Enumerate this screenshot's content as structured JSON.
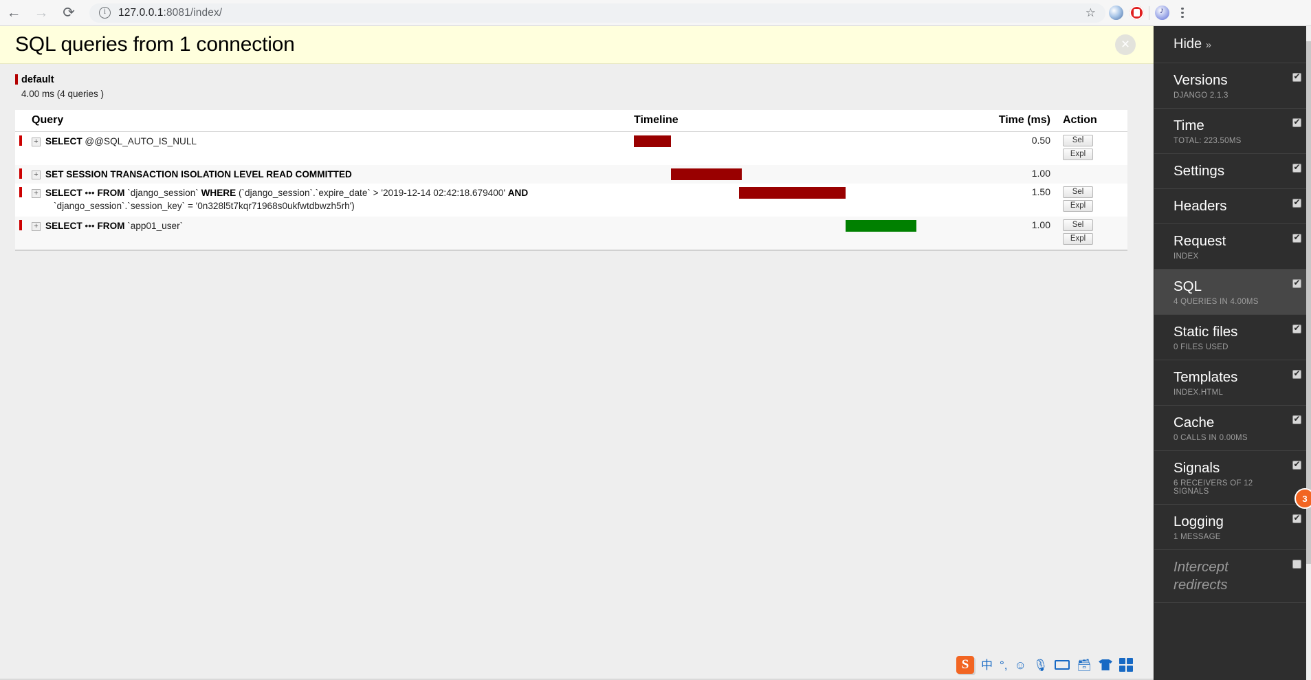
{
  "browser": {
    "back_label": "←",
    "forward_label": "→",
    "reload_label": "⟳",
    "url_host": "127.0.0.1",
    "url_rest": ":8081/index/",
    "star_label": "☆"
  },
  "djdt": {
    "title": "SQL queries from 1 connection",
    "close_label": "close",
    "connection": {
      "name": "default",
      "summary": "4.00 ms (4 queries )"
    },
    "table": {
      "headers": {
        "query": "Query",
        "timeline": "Timeline",
        "time": "Time (ms)",
        "action": "Action"
      },
      "rows": [
        {
          "toggle": "+",
          "sql_html": "<span class=\"kw\">SELECT</span> @@SQL_AUTO_IS_NULL",
          "sql_text": "SELECT @@SQL_AUTO_IS_NULL",
          "time": "0.50",
          "bar": {
            "left_pct": 0.0,
            "width_pct": 11.5,
            "color": "#990000"
          },
          "actions": [
            "Sel",
            "Expl"
          ]
        },
        {
          "toggle": "+",
          "sql_html": "<span class=\"kw\">SET SESSION TRANSACTION ISOLATION LEVEL READ COMMITTED</span>",
          "sql_text": "SET SESSION TRANSACTION ISOLATION LEVEL READ COMMITTED",
          "time": "1.00",
          "bar": {
            "left_pct": 11.5,
            "width_pct": 22.0,
            "color": "#990000"
          },
          "actions": []
        },
        {
          "toggle": "+",
          "sql_html": "<span class=\"kw\">SELECT</span> ••• <span class=\"kw\">FROM</span> `django_session` <span class=\"kw\">WHERE</span> (`django_session`.`expire_date` &gt; '2019-12-14 02:42:18.679400' <span class=\"kw\">AND</span><span class=\"q2\">`django_session`.`session_key` = '0n328l5t7kqr71968s0ukfwtdbwzh5rh')</span>",
          "sql_text": "SELECT ••• FROM `django_session` WHERE (`django_session`.`expire_date` > '2019-12-14 02:42:18.679400' AND `django_session`.`session_key` = '0n328l5t7kqr71968s0ukfwtdbwzh5rh')",
          "time": "1.50",
          "bar": {
            "left_pct": 32.5,
            "width_pct": 33.0,
            "color": "#990000"
          },
          "actions": [
            "Sel",
            "Expl"
          ]
        },
        {
          "toggle": "+",
          "sql_html": "<span class=\"kw\">SELECT</span> ••• <span class=\"kw\">FROM</span> `app01_user`",
          "sql_text": "SELECT ••• FROM `app01_user`",
          "time": "1.00",
          "bar": {
            "left_pct": 65.5,
            "width_pct": 22.0,
            "color": "#008000"
          },
          "actions": [
            "Sel",
            "Expl"
          ]
        }
      ]
    },
    "sidebar": {
      "hide_label": "Hide",
      "hide_chevron": "»",
      "panels": [
        {
          "title": "Versions",
          "sub": "Django 2.1.3",
          "checked": true,
          "active": false,
          "disabled": false
        },
        {
          "title": "Time",
          "sub": "Total: 223.50ms",
          "checked": true,
          "active": false,
          "disabled": false
        },
        {
          "title": "Settings",
          "sub": "",
          "checked": true,
          "active": false,
          "disabled": false
        },
        {
          "title": "Headers",
          "sub": "",
          "checked": true,
          "active": false,
          "disabled": false
        },
        {
          "title": "Request",
          "sub": "index",
          "checked": true,
          "active": false,
          "disabled": false
        },
        {
          "title": "SQL",
          "sub": "4 queries in 4.00ms",
          "checked": true,
          "active": true,
          "disabled": false
        },
        {
          "title": "Static files",
          "sub": "0 files used",
          "checked": true,
          "active": false,
          "disabled": false
        },
        {
          "title": "Templates",
          "sub": "index.html",
          "checked": true,
          "active": false,
          "disabled": false
        },
        {
          "title": "Cache",
          "sub": "0 calls in 0.00ms",
          "checked": true,
          "active": false,
          "disabled": false
        },
        {
          "title": "Signals",
          "sub": "6 receivers of 12 signals",
          "checked": true,
          "active": false,
          "disabled": false
        },
        {
          "title": "Logging",
          "sub": "1 message",
          "checked": true,
          "active": false,
          "disabled": false
        },
        {
          "title": "Intercept redirects",
          "sub": "",
          "checked": false,
          "active": false,
          "disabled": true
        }
      ]
    }
  },
  "float_badge": {
    "label": "3"
  },
  "ime": {
    "logo": "S",
    "mode": "中",
    "punct": "°,",
    "emoji": "☺",
    "voice": "☰",
    "keyboard": "keyboard",
    "toolbox": "toolbox",
    "skin": "skin",
    "apps": "apps"
  },
  "colors": {
    "header_bg": "#ffffdd",
    "sidebar_bg": "#2e2e2e",
    "sidebar_active": "#474747",
    "bar_red": "#990000",
    "bar_green": "#008000",
    "accent_red": "#cc0000"
  }
}
